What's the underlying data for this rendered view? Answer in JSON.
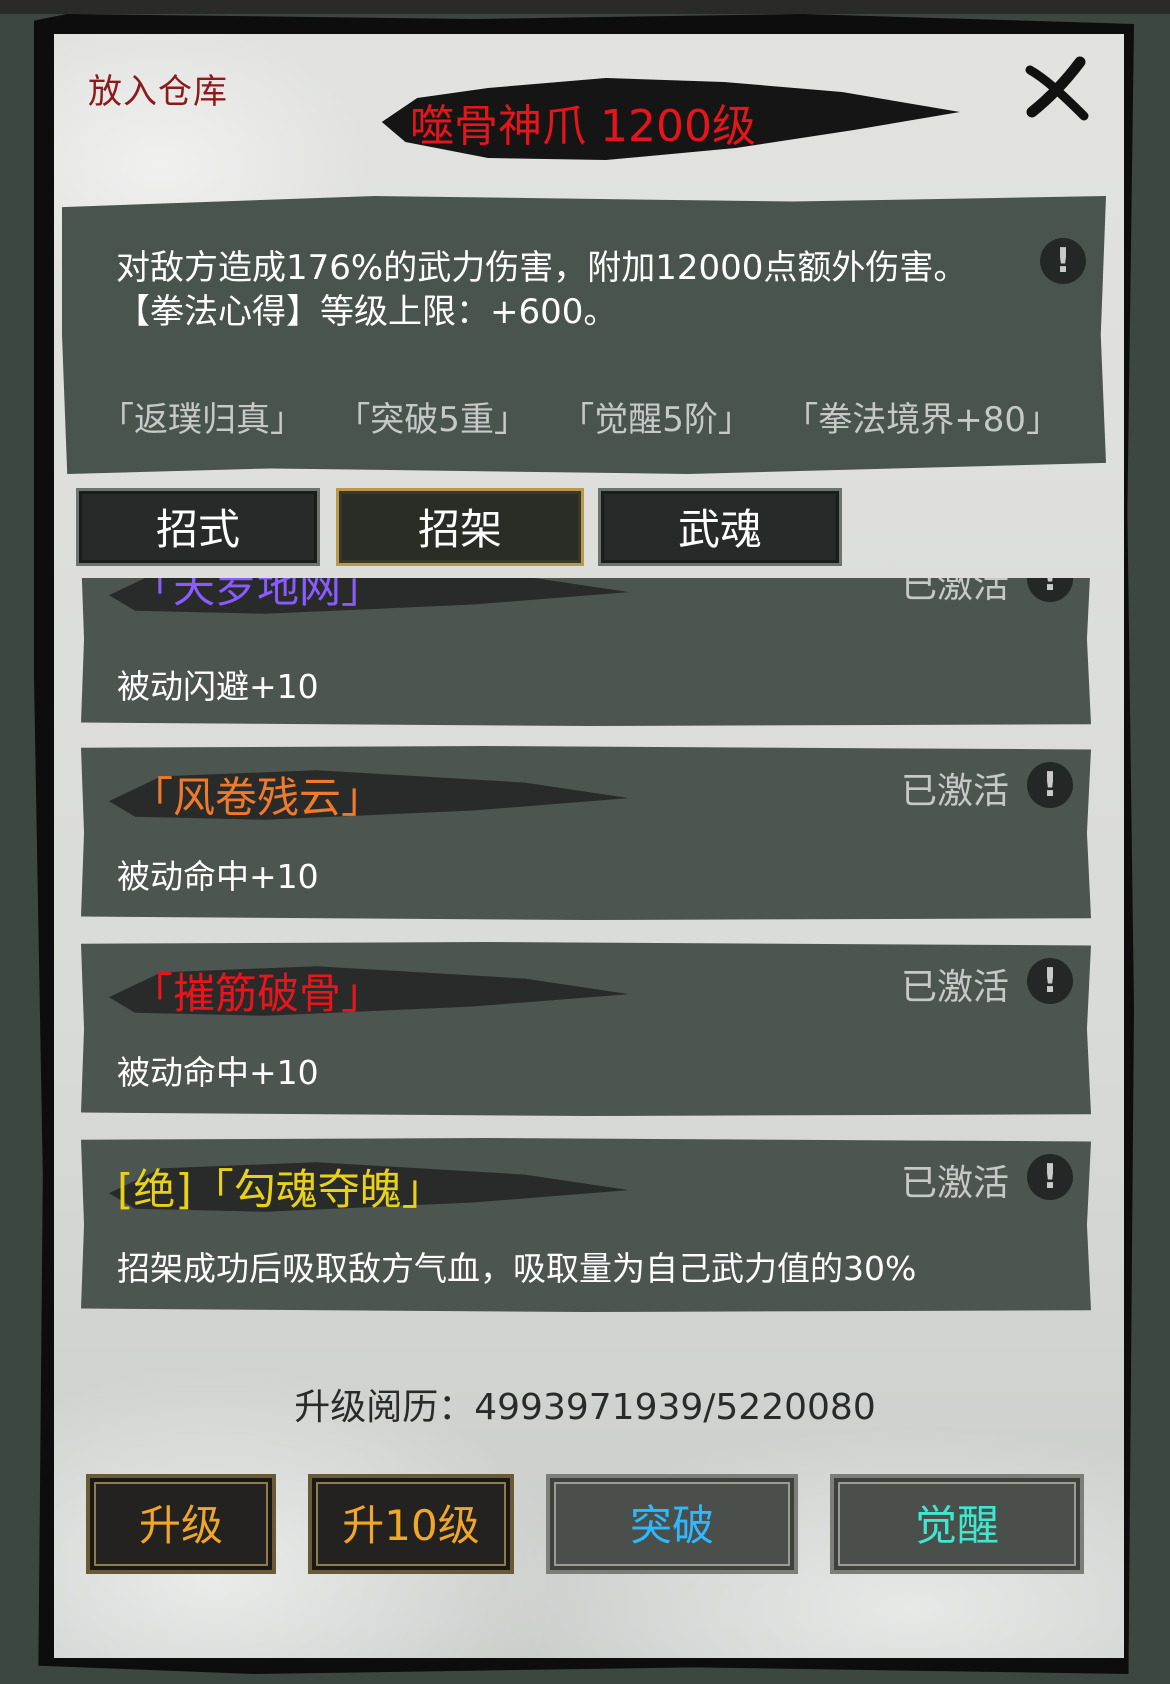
{
  "header": {
    "deposit_label": "放入仓库",
    "item_title": "噬骨神爪 1200级"
  },
  "description": {
    "line1": "对敌方造成176%的武力伤害，附加12000点额外伤害。",
    "line2": "【拳法心得】等级上限：+600。",
    "tags": [
      "「返璞归真」",
      "「突破5重」",
      "「觉醒5阶」",
      "「拳法境界+80」"
    ]
  },
  "tabs": [
    {
      "label": "招式",
      "active": false
    },
    {
      "label": "招架",
      "active": true
    },
    {
      "label": "武魂",
      "active": false
    }
  ],
  "skills": [
    {
      "name": "「天罗地网」",
      "color": "#8a5bff",
      "status": "已激活",
      "desc": "被动闪避+10"
    },
    {
      "name": "「风卷残云」",
      "color": "#f07a2a",
      "status": "已激活",
      "desc": "被动命中+10"
    },
    {
      "name": "「摧筋破骨」",
      "color": "#e8151b",
      "status": "已激活",
      "desc": "被动命中+10"
    },
    {
      "name": "[绝]「勾魂夺魄」",
      "color": "#e9d11a",
      "status": "已激活",
      "desc": "招架成功后吸取敌方气血，吸取量为自己武力值的30%"
    }
  ],
  "exp": {
    "label": "升级阅历：4993971939/5220080"
  },
  "buttons": {
    "upgrade": "升级",
    "upgrade10": "升10级",
    "breakthrough": "突破",
    "awaken": "觉醒"
  },
  "colors": {
    "upgrade_text": "#f0a628",
    "breakthrough_text": "#2fb8ff",
    "awaken_text": "#3fe6d0"
  }
}
